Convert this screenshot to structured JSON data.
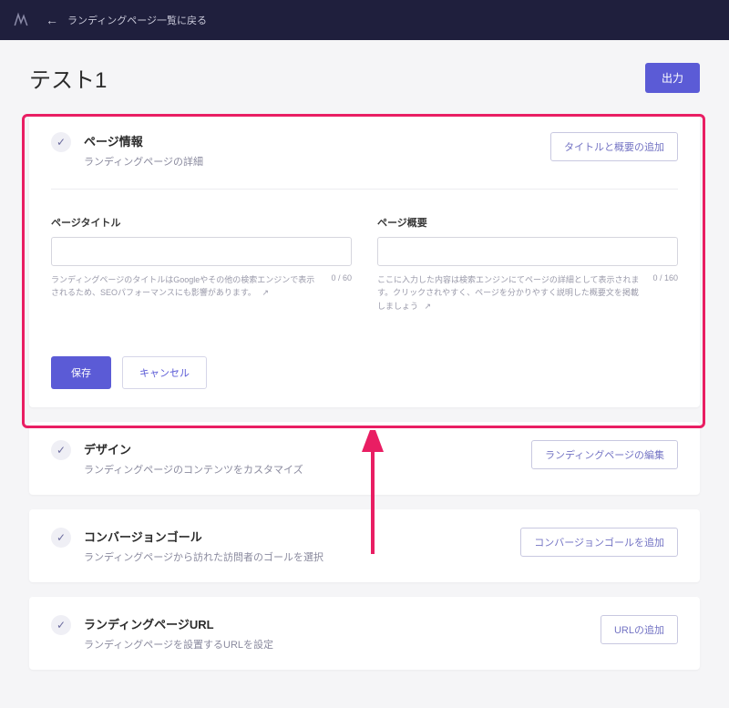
{
  "header": {
    "back_label": "ランディングページ一覧に戻る"
  },
  "page": {
    "title": "テスト1",
    "output_btn": "出力"
  },
  "sections": {
    "page_info": {
      "title": "ページ情報",
      "sub": "ランディングページの詳細",
      "action": "タイトルと概要の追加",
      "fields": {
        "title": {
          "label": "ページタイトル",
          "help": "ランディングページのタイトルはGoogleやその他の検索エンジンで表示されるため、SEOパフォーマンスにも影響があります。",
          "count": "0 / 60"
        },
        "summary": {
          "label": "ページ概要",
          "help": "ここに入力した内容は検索エンジンにてページの詳細として表示されます。クリックされやすく、ページを分かりやすく説明した概要文を掲載しましょう",
          "count": "0 / 160"
        }
      },
      "save": "保存",
      "cancel": "キャンセル"
    },
    "design": {
      "title": "デザイン",
      "sub": "ランディングページのコンテンツをカスタマイズ",
      "action": "ランディングページの編集"
    },
    "conversion": {
      "title": "コンバージョンゴール",
      "sub": "ランディングページから訪れた訪問者のゴールを選択",
      "action": "コンバージョンゴールを追加"
    },
    "url": {
      "title": "ランディングページURL",
      "sub": "ランディングページを設置するURLを設定",
      "action": "URLの追加"
    }
  },
  "annotation": {
    "highlight_color": "#e91e63"
  }
}
